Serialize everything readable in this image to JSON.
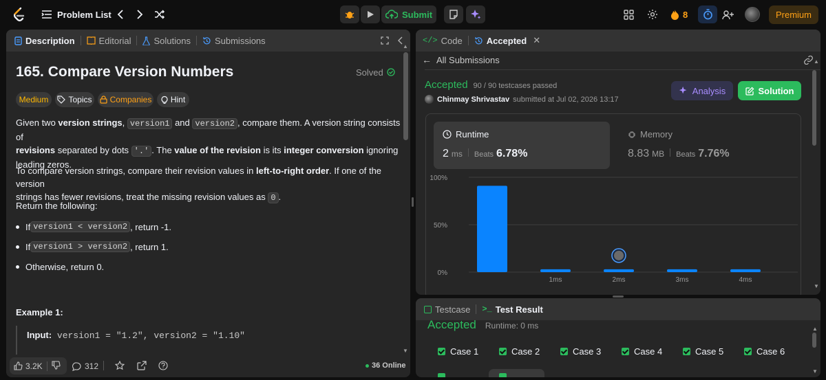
{
  "topbar": {
    "problem_list": "Problem List",
    "submit": "Submit",
    "streak_count": "8",
    "premium": "Premium"
  },
  "left": {
    "tabs": [
      "Description",
      "Editorial",
      "Solutions",
      "Submissions"
    ],
    "title": "165. Compare Version Numbers",
    "solved": "Solved",
    "chips": [
      "Medium",
      "Topics",
      "Companies",
      "Hint"
    ],
    "p1": {
      "a": "Given two ",
      "b": "version strings",
      "c": ", ",
      "d": "version1",
      "e": " and ",
      "f": "version2",
      "g": ", compare them. A version string consists of",
      "h": "revisions",
      "i": " separated by dots ",
      "j": "'.'",
      "k": ". The ",
      "l": "value of the revision",
      "m": " is its ",
      "n": "integer conversion",
      "o": " ignoring",
      "p": "leading zeros."
    },
    "p2": {
      "a": "To compare version strings, compare their revision values in ",
      "b": "left-to-right order",
      "c": ". If one of the version",
      "d": "strings has fewer revisions, treat the missing revision values as ",
      "e": "0",
      "f": "."
    },
    "p3": "Return the following:",
    "bullets": [
      {
        "pre": "If ",
        "code": "version1 < version2",
        "post": ", return -1."
      },
      {
        "pre": "If ",
        "code": "version1 > version2",
        "post": ", return 1."
      },
      {
        "pre": "Otherwise, return 0.",
        "code": "",
        "post": ""
      }
    ],
    "example_title": "Example 1:",
    "example_input_label": "Input:",
    "example_input": "version1 = \"1.2\", version2 = \"1.10\"",
    "footer": {
      "likes": "3.2K",
      "comments": "312",
      "online": "36 Online"
    }
  },
  "right": {
    "tabs": [
      "Code",
      "Accepted"
    ],
    "back": "All Submissions",
    "status": "Accepted",
    "passed": "90 / 90 testcases passed",
    "user": "Chinmay Shrivastav",
    "submitted": "submitted at Jul 02, 2026 13:17",
    "analysis": "Analysis",
    "solution": "Solution",
    "runtime": {
      "label": "Runtime",
      "value": "2",
      "unit": "ms",
      "beats_label": "Beats",
      "beats": "6.78%"
    },
    "memory": {
      "label": "Memory",
      "value": "8.83",
      "unit": "MB",
      "beats_label": "Beats",
      "beats": "7.76%"
    }
  },
  "chart_data": {
    "type": "bar",
    "y_tick_labels": [
      "100%",
      "50%",
      "0%"
    ],
    "ylim": [
      0,
      100
    ],
    "grid": true,
    "x_tick_labels": [
      "1ms",
      "2ms",
      "3ms",
      "4ms"
    ],
    "values": [
      91,
      3,
      3,
      3,
      3
    ],
    "user_bin_index": 2
  },
  "bottom": {
    "tabs": [
      "Testcase",
      "Test Result"
    ],
    "status": "Accepted",
    "runtime": "Runtime: 0 ms",
    "cases": [
      "Case 1",
      "Case 2",
      "Case 3",
      "Case 4",
      "Case 5",
      "Case 6"
    ]
  },
  "colors": {
    "accent": "#ffa116",
    "success": "#2cbb5d",
    "bar": "#0a84ff"
  }
}
